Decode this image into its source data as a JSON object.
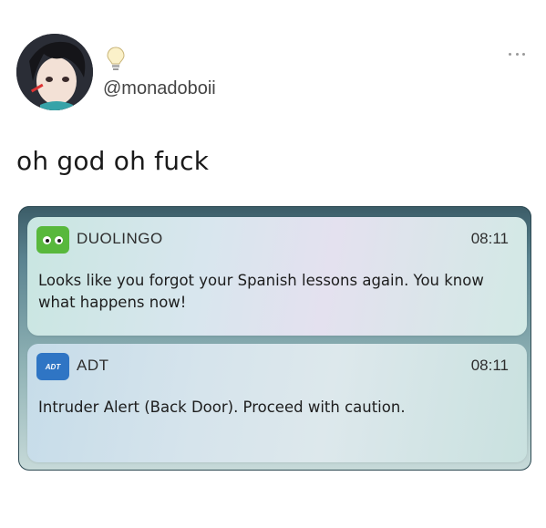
{
  "tweet": {
    "username": "@monadoboii",
    "text": "oh god oh fuck",
    "more_icon": "more-dots-icon",
    "emoji_icon": "lightbulb-icon"
  },
  "notifications": [
    {
      "app": "DUOLINGO",
      "icon": "duolingo-owl-icon",
      "time": "08:11",
      "message": "Looks like you forgot your Spanish lessons again. You know what happens now!"
    },
    {
      "app": "ADT",
      "icon": "adt-logo-icon",
      "icon_text": "ADT",
      "time": "08:11",
      "message": "Intruder Alert (Back Door). Proceed with caution."
    }
  ],
  "colors": {
    "duolingo_green": "#58b83c",
    "adt_blue": "#2f75c4"
  }
}
